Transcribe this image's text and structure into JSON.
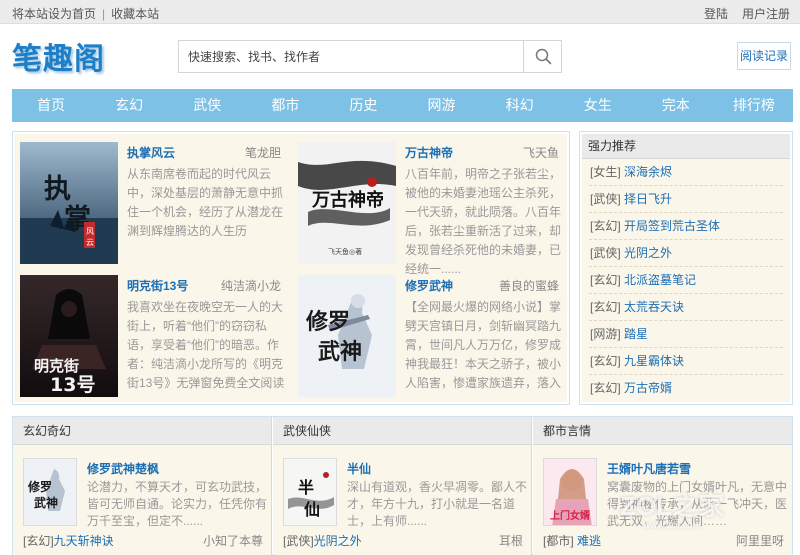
{
  "topbar": {
    "set_home": "将本站设为首页",
    "separator": "|",
    "bookmark": "收藏本站",
    "login": "登陆",
    "register": "用户注册"
  },
  "header": {
    "logo": "笔趣阁",
    "search_placeholder": "快速搜索、找书、找作者",
    "search_icon": "magnifier-icon",
    "history": "阅读记录"
  },
  "nav": [
    "首页",
    "玄幻",
    "武侠",
    "都市",
    "历史",
    "网游",
    "科幻",
    "女生",
    "完本",
    "排行榜"
  ],
  "featured": [
    {
      "title": "执掌风云",
      "author": "笔龙胆",
      "desc": "从东南席卷而起的时代风云中，深处基层的萧静无意中抓住一个机会，经历了从潜龙在渊到辉煌腾达的人生历程。......",
      "cover_text": "执掌风云"
    },
    {
      "title": "万古神帝",
      "author": "飞天鱼",
      "desc": "八百年前，明帝之子张若尘，被他的未婚妻池瑶公主杀死，一代天骄，就此陨落。八百年后，张若尘重新活了过来，却发现曾经杀死他的未婚妻，已经统一......",
      "cover_text": "万古神帝"
    },
    {
      "title": "明克街13号",
      "author": "纯洁滴小龙",
      "desc": "我喜欢坐在夜晚空无一人的大街上，听着“他们”的窃窃私语，享受着“他们”的暗恶。作者：纯洁滴小龙所写的《明克街13号》无弹窗免费全文阅读为转载作品章节由网友发......",
      "cover_text": "明克街13号"
    },
    {
      "title": "修罗武神",
      "author": "善良的蜜蜂",
      "desc": "【全网最火爆的网络小说】掌劈天宫镇日月，剑斩幽冥踏九霄，世间凡人万万亿，修罗成神我最狂！本天之骄子，被小人陷害，惨遭家族遗弃，落入凡界后，天赋觉醒，我楚枫......",
      "cover_text": "修罗武神"
    }
  ],
  "recommend": {
    "title": "强力推荐",
    "items": [
      {
        "cat": "[女生]",
        "title": "深海余烬"
      },
      {
        "cat": "[武侠]",
        "title": "择日飞升"
      },
      {
        "cat": "[玄幻]",
        "title": "开局签到荒古圣体"
      },
      {
        "cat": "[武侠]",
        "title": "光阴之外"
      },
      {
        "cat": "[玄幻]",
        "title": "北派盗墓笔记"
      },
      {
        "cat": "[玄幻]",
        "title": "太荒吞天诀"
      },
      {
        "cat": "[网游]",
        "title": "踏星"
      },
      {
        "cat": "[玄幻]",
        "title": "九星霸体诀"
      },
      {
        "cat": "[玄幻]",
        "title": "万古帝婿"
      }
    ]
  },
  "categories": [
    {
      "head": "玄幻奇幻",
      "title": "修罗武神楚枫",
      "desc": "论潜力，不算天才，可玄功武技，皆可无师自通。论实力，任凭你有万千至宝，但定不......",
      "foot_cat": "[玄幻]",
      "foot_title": "九天斩神诀",
      "foot_author": "小知了本尊"
    },
    {
      "head": "武侠仙侠",
      "title": "半仙",
      "desc": "深山有道观，香火早凋零。鄙人不才，年方十九，打小就是一名道士，上有师......",
      "foot_cat": "[武侠]",
      "foot_title": "光阴之外",
      "foot_author": "耳根"
    },
    {
      "head": "都市言情",
      "title": "王婿叶凡唐若雪",
      "desc": "窝囊废物的上门女婿叶凡，无意中得到神秘传承，从此一飞冲天，医武无双，光耀人间……",
      "foot_cat": "[都市]",
      "foot_title": "难逃",
      "foot_author": "阿里里呀"
    }
  ],
  "watermark": {
    "main": "ZOL之家",
    "sub": "www.zol.com"
  }
}
